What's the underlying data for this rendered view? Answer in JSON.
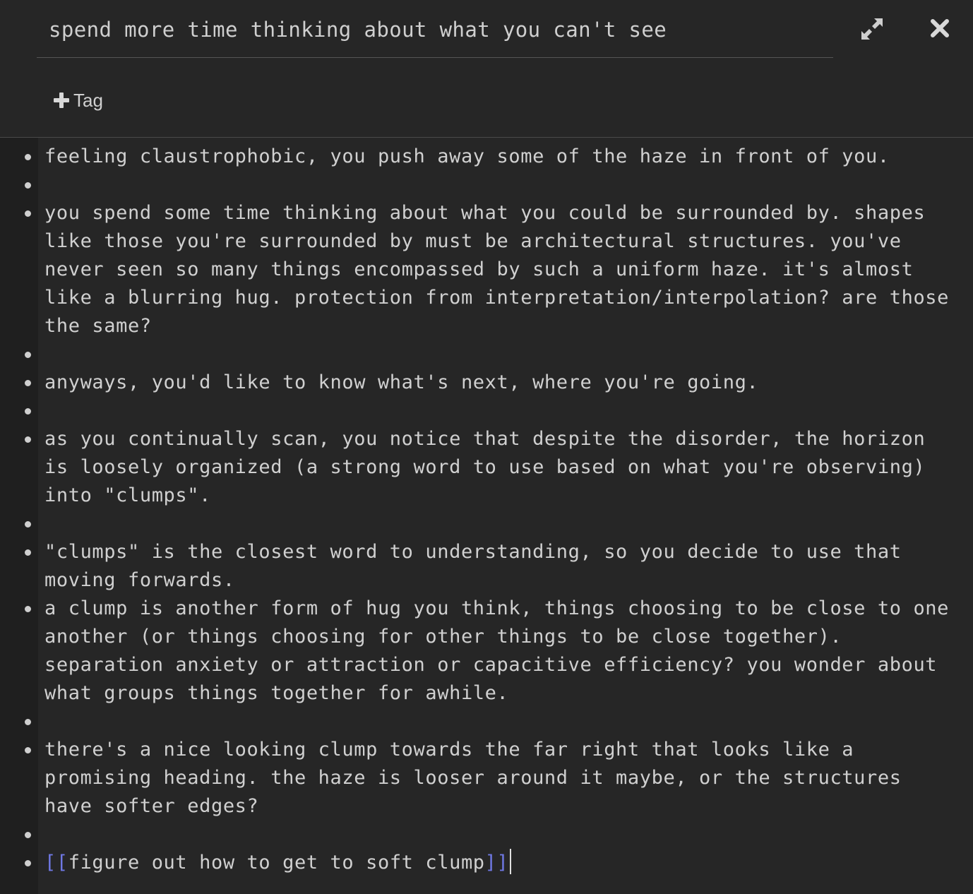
{
  "header": {
    "title": "spend more time thinking about what you can't see",
    "expand_icon": "expand-arrows-icon",
    "close_icon": "close-x-icon",
    "tag_button": {
      "icon": "plus-icon",
      "label": "Tag"
    }
  },
  "colors": {
    "background": "#262626",
    "gutter": "#1f1f1f",
    "text": "#d0d0d0",
    "link_bracket": "#6f78e3"
  },
  "editor": {
    "lines": [
      "feeling claustrophobic, you push away some of the haze in front of you.",
      "",
      "you spend some time thinking about what you could be surrounded by. shapes like those you're surrounded by must be architectural structures. you've never seen so many things encompassed by such a uniform haze. it's almost like a blurring hug. protection from interpretation/interpolation? are those the same?",
      "",
      "anyways, you'd like to know what's next, where you're going.",
      "",
      "as you continually scan, you notice that despite the disorder, the horizon is loosely organized (a strong word to use based on what you're observing) into \"clumps\".",
      "",
      "\"clumps\" is the closest word to understanding, so you decide to use that moving forwards.",
      "a clump is another form of hug you think, things choosing to be close to one another (or things choosing for other things to be close together). separation anxiety or attraction or capacitive efficiency? you wonder about what groups things together for awhile.",
      "",
      "there's a nice looking clump towards the far right that looks like a promising heading. the haze is looser around it maybe, or the structures have softer edges?",
      ""
    ],
    "last_line": {
      "open_bracket": "[[",
      "link_text": "figure out how to get to soft clump",
      "close_bracket": "]]"
    }
  }
}
